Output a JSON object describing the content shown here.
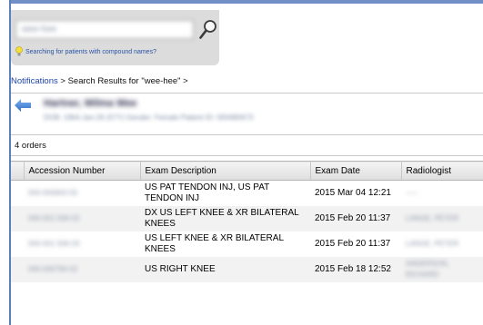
{
  "search": {
    "value": "wee-hee",
    "hint": "Searching for patients with compound names?"
  },
  "breadcrumb": {
    "notifications": "Notifications",
    "separator": " > ",
    "current": "Search Results for \"wee-hee\"",
    "trailing": " >"
  },
  "patient": {
    "name": "Hartner, Wilma Wee",
    "meta": "DOB: 1964-Jan-26 (57Y)      Gender: Female      Patient ID: 000480673"
  },
  "orders": {
    "count_label": "4 orders",
    "columns": [
      "Accession Number",
      "Exam Description",
      "Exam Date",
      "Radiologist"
    ],
    "rows": [
      {
        "accession": "000-000843-55",
        "description": "US PAT TENDON INJ, US PAT TENDON INJ",
        "date": "2015 Mar 04 12:21",
        "radiologist": "-----"
      },
      {
        "accession": "000-001 506-02",
        "description": "DX US LEFT KNEE & XR BILATERAL KNEES",
        "date": "2015 Feb 20 11:37",
        "radiologist": "LANGE, PETER"
      },
      {
        "accession": "000-001 506-03",
        "description": "US LEFT KNEE & XR BILATERAL KNEES",
        "date": "2015 Feb 20 11:37",
        "radiologist": "LANGE, PETER"
      },
      {
        "accession": "000-000794-02",
        "description": "US RIGHT KNEE",
        "date": "2015 Feb 18 12:52",
        "radiologist": "ANDERSON, RICHARD"
      }
    ]
  },
  "colors": {
    "accent_blue": "#5b7fc0",
    "link_blue": "#1f46a8",
    "panel_gray": "#dcdcdc"
  },
  "icons": {
    "search": "search-icon",
    "hint": "lightbulb-icon",
    "back": "back-arrow-icon"
  }
}
